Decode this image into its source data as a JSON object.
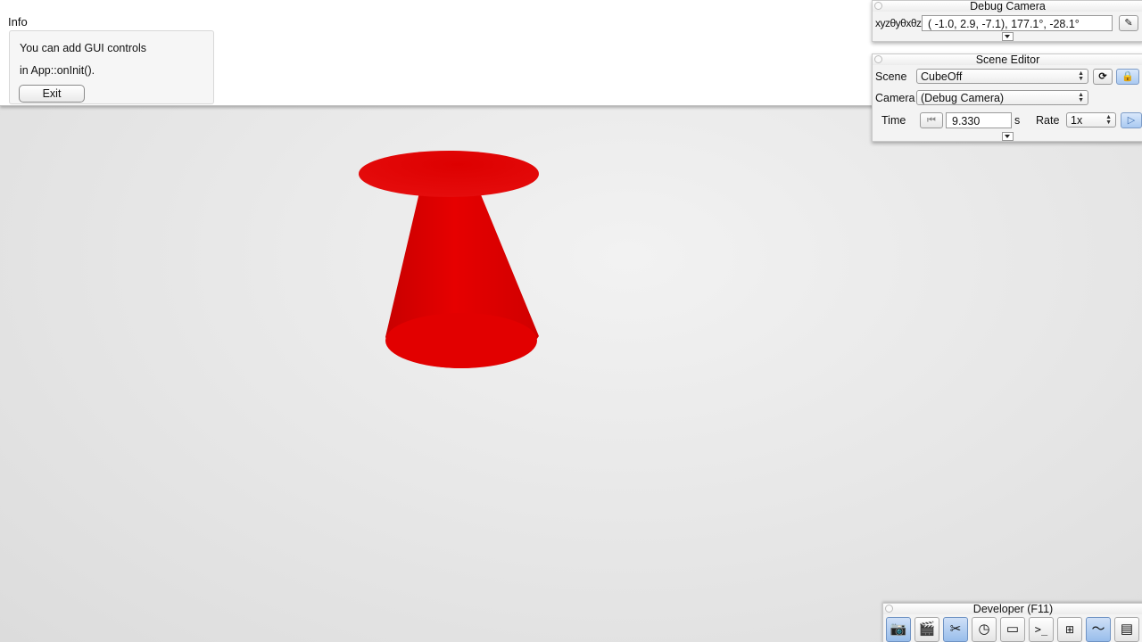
{
  "info_window": {
    "title": "Info",
    "line1": "You can add GUI controls",
    "line2": "in App::onInit().",
    "exit_label": "Exit"
  },
  "scene_object": {
    "description_color": "#e00000"
  },
  "debug_camera": {
    "title": "Debug Camera",
    "label": "xyzθyθxθz",
    "value": "( -1.0,   2.9,  -7.1),  177.1°, -28.1°",
    "edit_icon": "pencil-icon"
  },
  "scene_editor": {
    "title": "Scene Editor",
    "scene_label": "Scene",
    "scene_value": "CubeOff",
    "camera_label": "Camera",
    "camera_value": "(Debug Camera)",
    "time_label": "Time",
    "time_value": "9.330",
    "time_unit": "s",
    "rate_label": "Rate",
    "rate_value": "1x",
    "icons": [
      "reload-icon",
      "lock-icon",
      "rewind-icon",
      "play-icon"
    ]
  },
  "developer": {
    "title": "Developer (F11)",
    "tools": [
      "camera-icon",
      "clapperboard-icon",
      "tools-icon",
      "clock-icon",
      "new-window-icon",
      "terminal-icon",
      "scene-graph-icon",
      "profiler-icon",
      "document-icon"
    ]
  }
}
